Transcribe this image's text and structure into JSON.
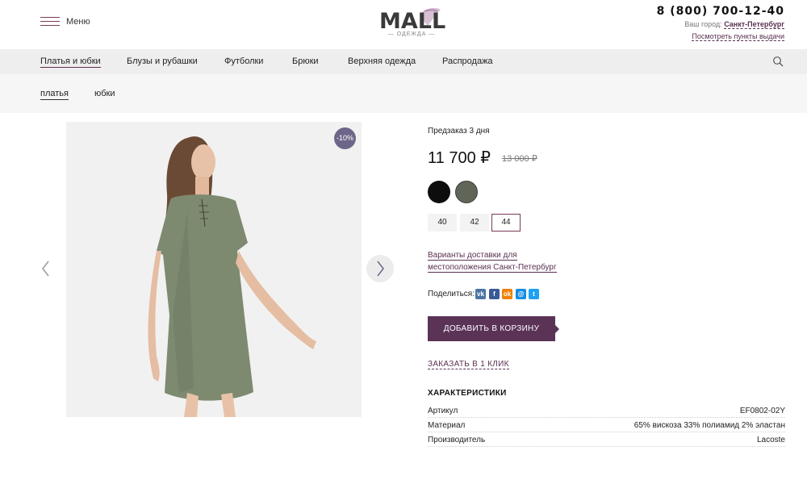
{
  "header": {
    "menu_label": "Меню",
    "logo_text": "MALL",
    "logo_sub": "— ОДЕЖДА —",
    "phone": "8 (800) 700-12-40",
    "city_prefix": "Ваш город:",
    "city": "Санкт-Петербург",
    "pickup_link": "Посмотреть пункты выдачи"
  },
  "catnav": {
    "items": [
      {
        "label": "Платья и юбки"
      },
      {
        "label": "Блузы и рубашки"
      },
      {
        "label": "Футболки"
      },
      {
        "label": "Брюки"
      },
      {
        "label": "Верхняя одежда"
      },
      {
        "label": "Распродажа"
      }
    ],
    "active": "Платья и юбки"
  },
  "subnav": {
    "items": [
      {
        "label": "платья"
      },
      {
        "label": "юбки"
      }
    ],
    "active": "платья"
  },
  "gallery": {
    "discount_badge": "-10%"
  },
  "product": {
    "availability": "Предзаказ 3 дня",
    "price": "11 700 ₽",
    "old_price": "13 000 ₽",
    "colors": [
      {
        "name": "black",
        "hex": "#0d0d0d"
      },
      {
        "name": "green",
        "hex": "#5f6658"
      }
    ],
    "sizes": [
      {
        "label": "40"
      },
      {
        "label": "42"
      },
      {
        "label": "44"
      }
    ],
    "selected_size": "44",
    "delivery_line1": "Варианты доставки для",
    "delivery_line2": "местоположения Санкт-Петербург",
    "share_label": "Поделиться:",
    "social": [
      {
        "name": "vk",
        "glyph": "vk",
        "color": "#4c75a3"
      },
      {
        "name": "facebook",
        "glyph": "f",
        "color": "#3b5998"
      },
      {
        "name": "odnoklassniki",
        "glyph": "ok",
        "color": "#ee8208"
      },
      {
        "name": "moimir",
        "glyph": "@",
        "color": "#168de2"
      },
      {
        "name": "twitter",
        "glyph": "t",
        "color": "#1da1f2"
      }
    ],
    "add_to_cart": "ДОБАВИТЬ В КОРЗИНУ",
    "one_click": "ЗАКАЗАТЬ В 1 КЛИК",
    "characteristics_title": "ХАРАКТЕРИСТИКИ",
    "characteristics": [
      {
        "key": "Артикул",
        "value": "EF0802-02Y"
      },
      {
        "key": "Материал",
        "value": "65% вискоза 33% полиамид 2% эластан"
      },
      {
        "key": "Производитель",
        "value": "Lacoste"
      }
    ]
  },
  "colors": {
    "accent": "#5b3357",
    "nav_bg": "#eeeeee",
    "subnav_bg": "#f6f6f6",
    "badge": "#6e6689"
  }
}
